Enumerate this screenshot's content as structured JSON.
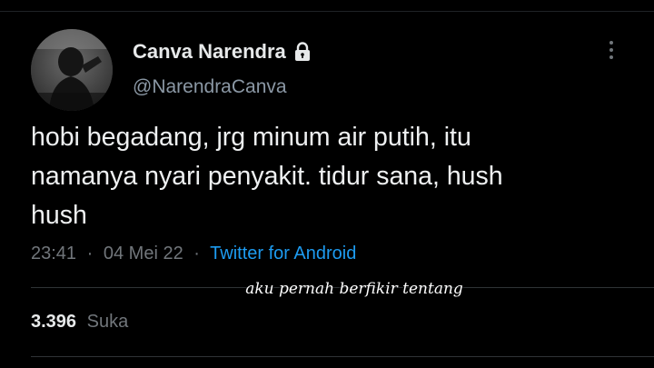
{
  "tweet": {
    "display_name": "Canva Narendra",
    "handle": "@NarendraCanva",
    "text": "hobi begadang, jrg minum air putih, itu\nnamanya nyari penyakit. tidur sana, hush\nhush",
    "time": "23:41",
    "date": "04 Mei 22",
    "separator": "·",
    "source": "Twitter for Android",
    "likes_count": "3.396",
    "likes_label": "Suka",
    "protected_icon": "lock-icon",
    "menu_icon": "more-vertical-icon"
  },
  "overlay": {
    "caption": "aku pernah berfikir tentang"
  },
  "colors": {
    "background": "#000000",
    "text_primary": "#e7e9ea",
    "text_secondary": "#71767b",
    "link": "#1d9bf0"
  }
}
